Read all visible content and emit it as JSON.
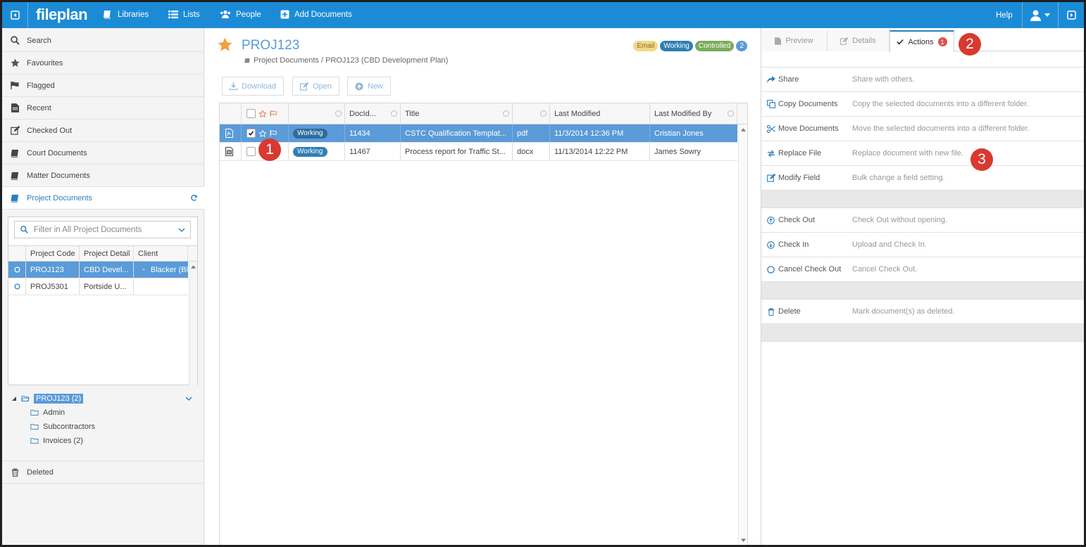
{
  "topbar": {
    "logo": "fileplan",
    "nav": [
      "Libraries",
      "Lists",
      "People",
      "Add Documents"
    ],
    "help": "Help"
  },
  "sidebar": {
    "items": [
      "Search",
      "Favourites",
      "Flagged",
      "Recent",
      "Checked Out",
      "Court Documents",
      "Matter Documents",
      "Project Documents"
    ],
    "filter_placeholder": "Filter in All Project Documents",
    "table_headers": [
      "Project Code",
      "Project Detail",
      "Client"
    ],
    "rows": [
      {
        "code": "PROJ123",
        "detail": "CBD Devel...",
        "client": "Blacker (Bl"
      },
      {
        "code": "PROJ5301",
        "detail": "Portside U...",
        "client": ""
      }
    ],
    "tree": {
      "root": "PROJ123 (2)",
      "children": [
        "Admin",
        "Subcontractors",
        "Invoices (2)"
      ]
    },
    "deleted": "Deleted"
  },
  "main": {
    "title": "PROJ123",
    "breadcrumb": "Project Documents / PROJ123 (CBD Development Plan)",
    "badges": {
      "email": "Email",
      "working": "Working",
      "controlled": "Controlled",
      "count": "2"
    },
    "toolbar": {
      "download": "Download",
      "open": "Open",
      "new": "New"
    },
    "columns": {
      "docid": "DocId...",
      "title": "Title",
      "modified": "Last Modified",
      "modified_by": "Last Modified By"
    },
    "rows": [
      {
        "status": "Working",
        "docid": "11434",
        "title": "CSTC Qualification Templat...",
        "ext": "pdf",
        "modified": "11/3/2014 12:36 PM",
        "by": "Cristian Jones"
      },
      {
        "status": "Working",
        "docid": "11467",
        "title": "Process report for Traffic St...",
        "ext": "docx",
        "modified": "11/13/2014 12:22 PM",
        "by": "James Sowry"
      }
    ]
  },
  "panel": {
    "tabs": {
      "preview": "Preview",
      "details": "Details",
      "actions": "Actions",
      "actions_count": "1"
    },
    "actions": [
      {
        "label": "Share",
        "desc": "Share with others."
      },
      {
        "label": "Copy Documents",
        "desc": "Copy the selected documents into a different folder."
      },
      {
        "label": "Move Documents",
        "desc": "Move the selected documents into a different folder."
      },
      {
        "label": "Replace File",
        "desc": "Replace document with new file."
      },
      {
        "label": "Modify Field",
        "desc": "Bulk change a field setting."
      },
      {
        "label": "Check Out",
        "desc": "Check Out without opening."
      },
      {
        "label": "Check In",
        "desc": "Upload and Check In."
      },
      {
        "label": "Cancel Check Out",
        "desc": "Cancel Check Out."
      },
      {
        "label": "Delete",
        "desc": "Mark document(s) as deleted."
      }
    ]
  },
  "markers": [
    "1",
    "2",
    "3"
  ]
}
